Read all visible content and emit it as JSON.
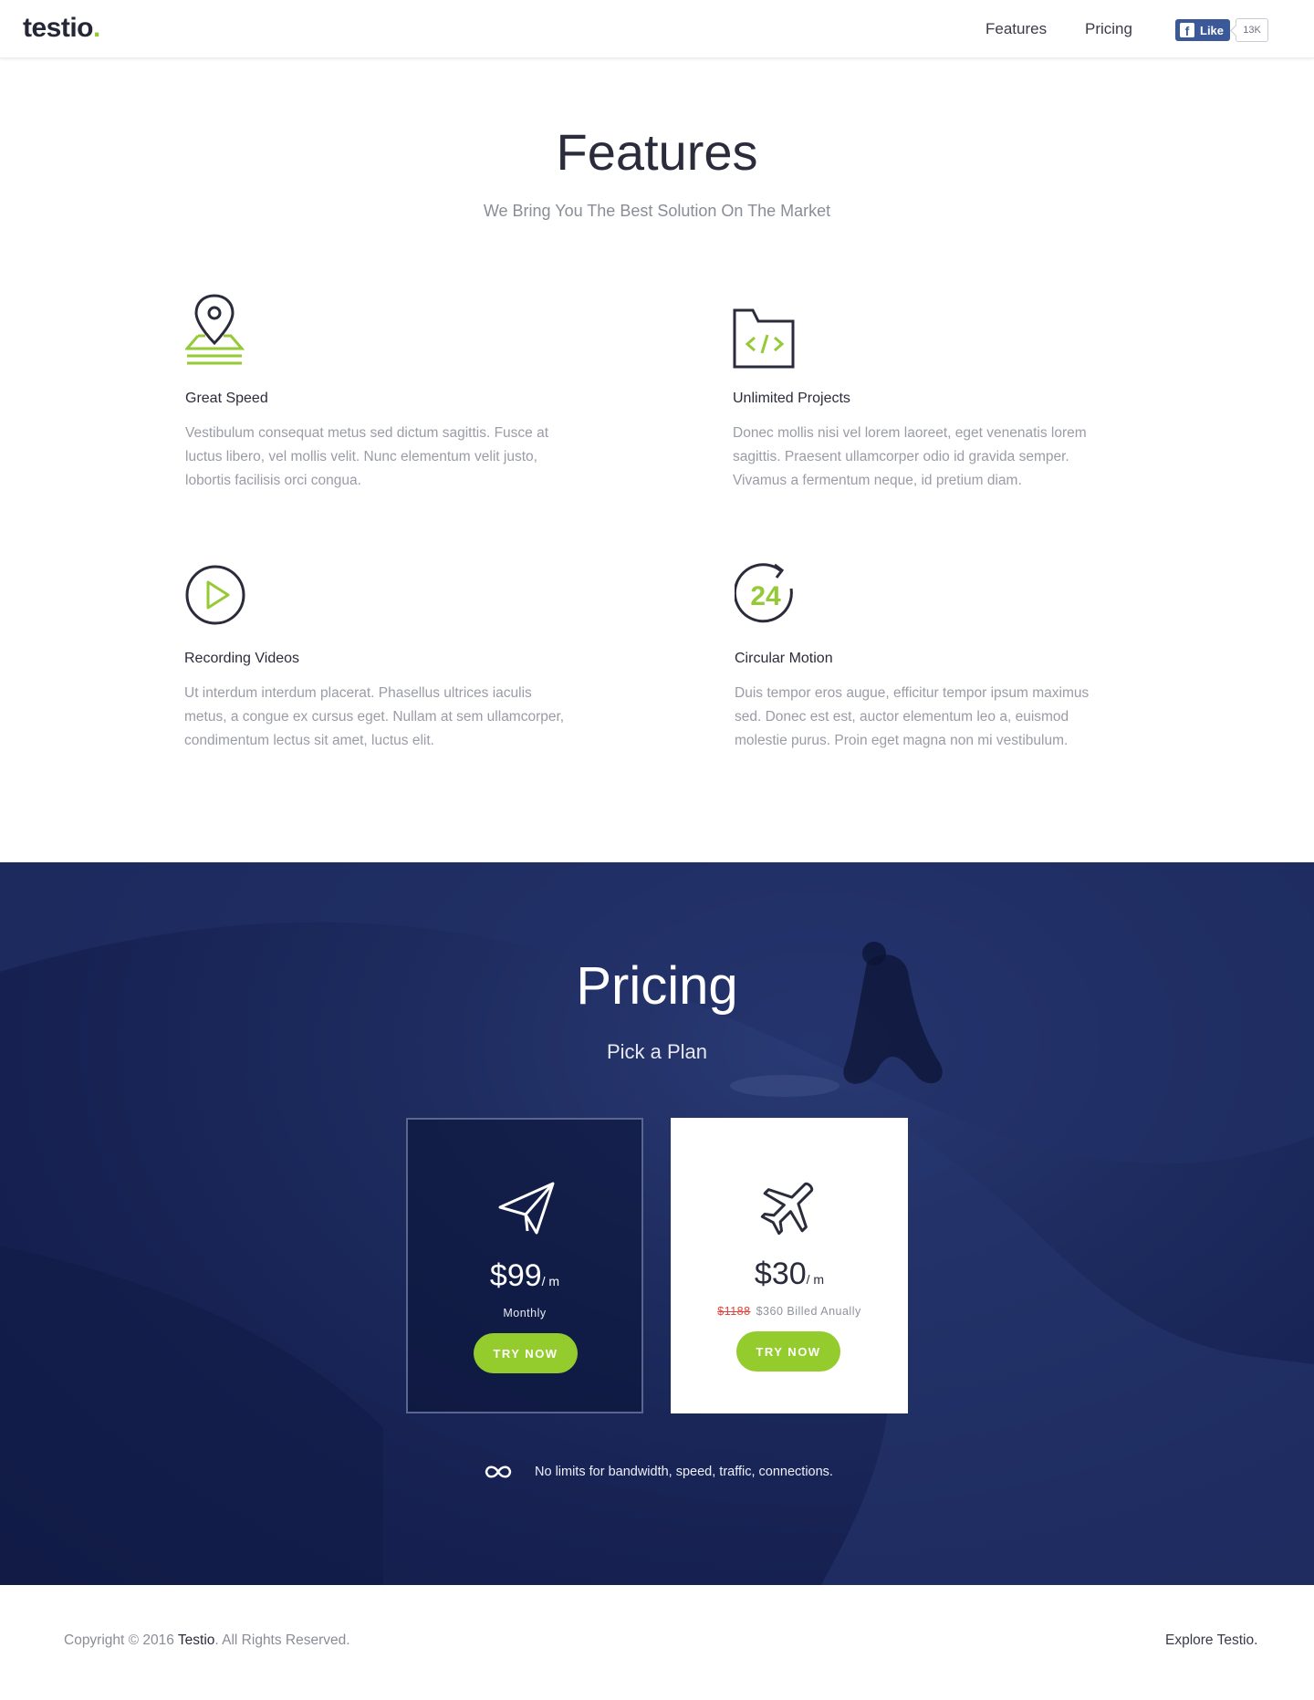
{
  "header": {
    "logo": "testio",
    "nav": {
      "features": "Features",
      "pricing": "Pricing"
    },
    "fb_like": {
      "label": "Like",
      "count": "13K"
    }
  },
  "features": {
    "title": "Features",
    "subtitle": "We Bring You The Best Solution On The Market",
    "items": [
      {
        "icon": "map-pin-icon",
        "title": "Great Speed",
        "text": "Vestibulum consequat metus sed dictum sagittis. Fusce at luctus libero, vel mollis velit. Nunc elementum velit justo, lobortis facilisis orci congua."
      },
      {
        "icon": "code-folder-icon",
        "title": "Unlimited Projects",
        "text": "Donec mollis nisi vel lorem laoreet, eget venenatis lorem sagittis. Praesent ullamcorper odio id gravida semper. Vivamus a fermentum neque, id pretium diam."
      },
      {
        "icon": "play-circle-icon",
        "title": "Recording Videos",
        "text": "Ut interdum interdum placerat. Phasellus ultrices iaculis metus, a congue ex cursus eget. Nullam at sem ullamcorper, condimentum lectus sit amet, luctus elit."
      },
      {
        "icon": "clock-24-icon",
        "title": "Circular Motion",
        "text": "Duis tempor eros augue, efficitur tempor ipsum maximus sed. Donec est est, auctor elementum leo a, euismod molestie purus. Proin eget magna non mi vestibulum."
      }
    ]
  },
  "pricing": {
    "title": "Pricing",
    "subtitle": "Pick a Plan",
    "plans": [
      {
        "icon": "paper-plane-icon",
        "price": "$99",
        "unit": "/ m",
        "period": "Monthly",
        "button": "TRY NOW"
      },
      {
        "icon": "airplane-icon",
        "price": "$30",
        "unit": "/ m",
        "old_price": "$1188",
        "period": "$360 Billed Anually",
        "button": "TRY NOW"
      }
    ],
    "note": "No limits for bandwidth, speed, traffic, connections."
  },
  "footer": {
    "copyright_pre": "Copyright © 2016 ",
    "brand": "Testio",
    "copyright_post": ". All Rights Reserved.",
    "explore": "Explore Testio."
  },
  "colors": {
    "accent": "#95cc2d",
    "dark": "#2b2c3b",
    "pricing_bg": "#1b2859",
    "facebook": "#3b5998"
  }
}
